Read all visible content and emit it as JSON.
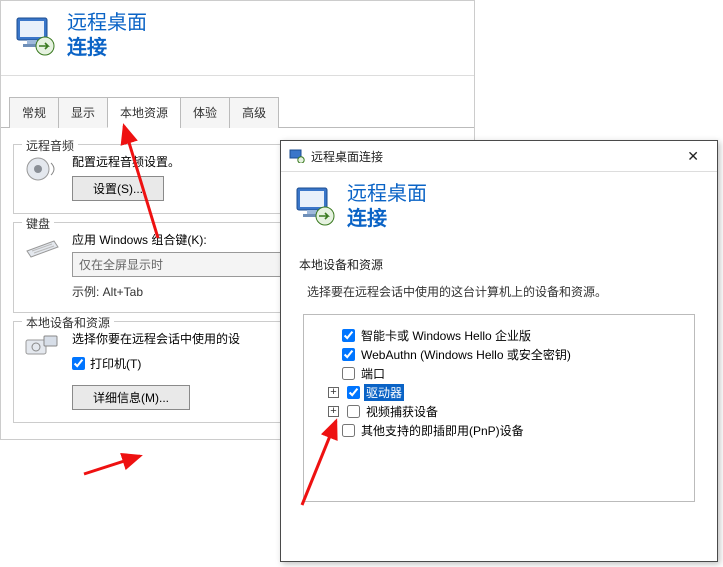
{
  "app": {
    "title_line1": "远程桌面",
    "title_line2": "连接"
  },
  "tabs": [
    {
      "label": "常规"
    },
    {
      "label": "显示"
    },
    {
      "label": "本地资源"
    },
    {
      "label": "体验"
    },
    {
      "label": "高级"
    }
  ],
  "tab_active_index": 2,
  "remote_audio": {
    "legend": "远程音频",
    "desc": "配置远程音频设置。",
    "settings_btn": "设置(S)..."
  },
  "keyboard": {
    "legend": "键盘",
    "desc": "应用 Windows 组合键(K):",
    "combo_value": "仅在全屏显示时",
    "example": "示例: Alt+Tab"
  },
  "local_devices": {
    "legend": "本地设备和资源",
    "desc": "选择你要在远程会话中使用的设",
    "printer_label": "打印机(T)",
    "details_btn": "详细信息(M)..."
  },
  "dialog": {
    "titlebar": "远程桌面连接",
    "title_line1": "远程桌面",
    "title_line2": "连接",
    "group_title": "本地设备和资源",
    "group_desc": "选择要在远程会话中使用的这台计算机上的设备和资源。",
    "tree": [
      {
        "checked": true,
        "label": "智能卡或 Windows Hello 企业版",
        "expander": null,
        "selected": false
      },
      {
        "checked": true,
        "label": "WebAuthn (Windows Hello 或安全密钥)",
        "expander": null,
        "selected": false
      },
      {
        "checked": false,
        "label": "端口",
        "expander": null,
        "selected": false
      },
      {
        "checked": true,
        "label": "驱动器",
        "expander": "+",
        "selected": true
      },
      {
        "checked": false,
        "label": "视频捕获设备",
        "expander": "+",
        "selected": false
      },
      {
        "checked": false,
        "label": "其他支持的即插即用(PnP)设备",
        "expander": null,
        "selected": false
      }
    ]
  }
}
